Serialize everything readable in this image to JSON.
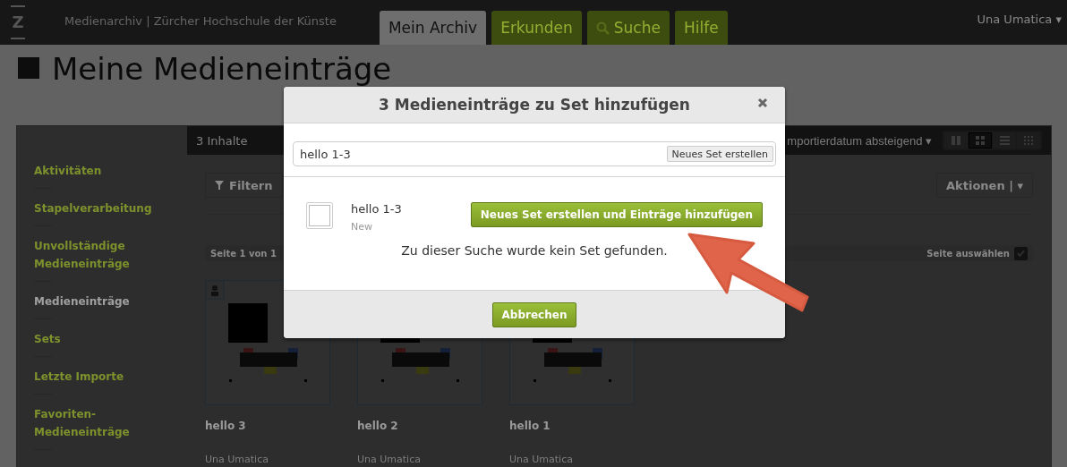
{
  "topbar": {
    "logo": "Z",
    "site": "Medienarchiv | Zürcher Hochschule der Künste",
    "tabs": [
      {
        "label": "Mein Archiv",
        "selected": true,
        "kind": "plain"
      },
      {
        "label": "Erkunden",
        "selected": false,
        "kind": "plain"
      },
      {
        "label": "Suche",
        "selected": false,
        "kind": "search"
      },
      {
        "label": "Hilfe",
        "selected": false,
        "kind": "plain"
      }
    ],
    "user": "Una Umatica ▾"
  },
  "page_title": "Meine Medieneinträge",
  "sidebar": {
    "items": [
      {
        "label": "Aktivitäten",
        "selected": false
      },
      {
        "label": "Stapelverarbeitung",
        "selected": false
      },
      {
        "label": "Unvollständige Medieneinträge",
        "selected": false
      },
      {
        "label": "Medieneinträge",
        "selected": true
      },
      {
        "label": "Sets",
        "selected": false
      },
      {
        "label": "Letzte Importe",
        "selected": false
      },
      {
        "label": "Favoriten-Medieneinträge",
        "selected": false
      }
    ]
  },
  "content": {
    "count": "3 Inhalte",
    "sort": "mportierdatum absteigend ▾",
    "views": [
      {
        "kind": "tiles",
        "selected": false
      },
      {
        "kind": "grid",
        "selected": true
      },
      {
        "kind": "list",
        "selected": false
      },
      {
        "kind": "dots",
        "selected": false
      }
    ],
    "filter_button": "Filtern",
    "actions_button": "Aktionen | ▾",
    "page_info": "Seite 1 von 1",
    "select_page": {
      "label": "Seite auswählen",
      "checked": true
    },
    "cards": [
      {
        "title": "hello 3",
        "author": "Una Umatica"
      },
      {
        "title": "hello 2",
        "author": "Una Umatica"
      },
      {
        "title": "hello 1",
        "author": "Una Umatica"
      }
    ]
  },
  "dialog": {
    "title": "3 Medieneinträge zu Set hinzufügen",
    "search_value": "hello 1-3",
    "create_button": "Neues Set erstellen",
    "new_set": {
      "name": "hello 1-3",
      "status": "New",
      "checked": false
    },
    "create_add_button": "Neues Set erstellen und Einträge hinzufügen",
    "message": "Zu dieser Suche wurde kein Set gefunden.",
    "cancel_button": "Abbrechen"
  }
}
